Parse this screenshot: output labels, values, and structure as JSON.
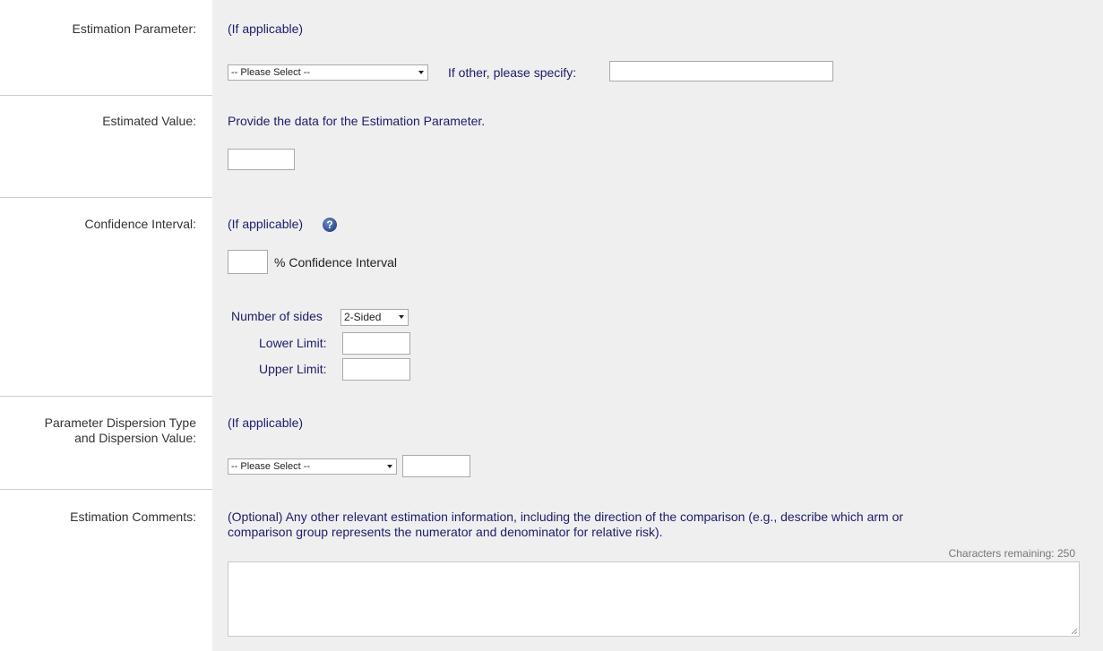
{
  "estimation_parameter": {
    "label": "Estimation Parameter:",
    "hint": "(If applicable)",
    "select_value": "-- Please Select --",
    "other_label": "If other, please specify:",
    "other_value": ""
  },
  "estimated_value": {
    "label": "Estimated Value:",
    "hint": "Provide the data for the Estimation Parameter.",
    "value": ""
  },
  "confidence_interval": {
    "label": "Confidence Interval:",
    "hint": "(If applicable)",
    "help_icon": "question-icon",
    "percent_value": "",
    "percent_label": "% Confidence Interval",
    "sides_label": "Number of sides",
    "sides_value": "2-Sided",
    "lower_label": "Lower Limit:",
    "lower_value": "",
    "upper_label": "Upper Limit:",
    "upper_value": ""
  },
  "dispersion": {
    "label_line1": "Parameter Dispersion Type",
    "label_line2": "and Dispersion Value:",
    "hint": "(If applicable)",
    "select_value": "-- Please Select --",
    "value": ""
  },
  "comments": {
    "label": "Estimation Comments:",
    "hint_line1": "(Optional) Any other relevant estimation information, including the direction of the comparison (e.g., describe which arm or",
    "hint_line2": "comparison group represents the numerator and denominator for relative risk).",
    "chars_remaining": "Characters remaining: 250",
    "value": ""
  }
}
